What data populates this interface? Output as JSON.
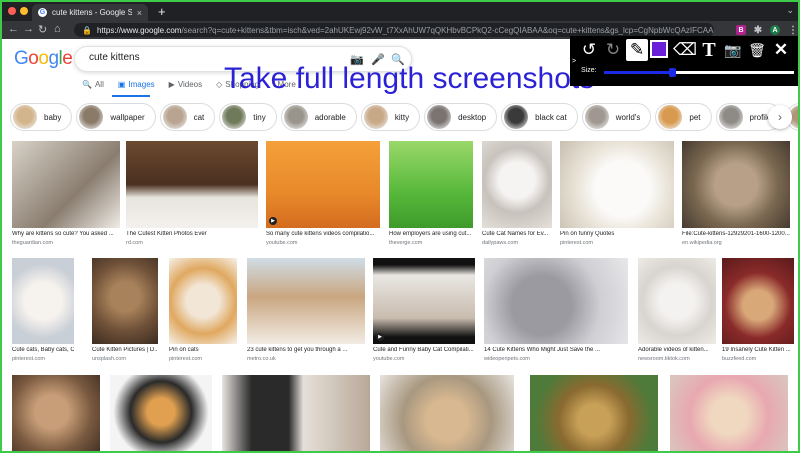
{
  "browser": {
    "tab_title": "cute kittens - Google Search",
    "tab_close": "×",
    "new_tab": "+",
    "tab_dropdown": "⌄",
    "url_host": "https://www.google.com",
    "url_path": "/search?q=cute+kittens&tbm=isch&ved=2ahUKEwj92vW_t7XxAhUW7qQKHbvBCPkQ2-cCegQIABAA&oq=cute+kittens&gs_lcp=CgNpbWcQAzIFCAAQsQMyAggAMgIIADIC",
    "nav_back": "←",
    "nav_forward": "→",
    "nav_reload": "↻",
    "nav_home": "⌂",
    "lock": "🔒",
    "ext_b": "B",
    "ext_puzzle": "✱",
    "ext_avatar": "A",
    "menu": "⋮",
    "colors": {
      "dot_red": "#ff5f57",
      "dot_yellow": "#febc2e",
      "dot_green": "#28c840"
    }
  },
  "google": {
    "logo_letters": [
      "G",
      "o",
      "o",
      "g",
      "l",
      "e"
    ],
    "logo_colors": [
      "#4285f4",
      "#ea4335",
      "#fbbc05",
      "#4285f4",
      "#34a853",
      "#ea4335"
    ],
    "search_value": "cute kittens",
    "camera_icon": "📷",
    "mic_icon": "🎤",
    "search_icon": "🔍",
    "tabs": [
      {
        "icon": "🔍",
        "label": "All"
      },
      {
        "icon": "▣",
        "label": "Images"
      },
      {
        "icon": "▶",
        "label": "Videos"
      },
      {
        "icon": "◇",
        "label": "Shopping"
      },
      {
        "icon": "",
        "label": ":  More"
      }
    ]
  },
  "overlay_text": "Take full length screenshots",
  "chips": [
    {
      "label": "baby",
      "thumb": "#d4b48a"
    },
    {
      "label": "wallpaper",
      "thumb": "#8a7a68"
    },
    {
      "label": "cat",
      "thumb": "#b8a490"
    },
    {
      "label": "tiny",
      "thumb": "#6f7a5a"
    },
    {
      "label": "adorable",
      "thumb": "#9a958c"
    },
    {
      "label": "kitty",
      "thumb": "#c9a888"
    },
    {
      "label": "desktop",
      "thumb": "#7a7370"
    },
    {
      "label": "black cat",
      "thumb": "#3a3a3a"
    },
    {
      "label": "world's",
      "thumb": "#a09890"
    },
    {
      "label": "pet",
      "thumb": "#d89a4e"
    },
    {
      "label": "profile",
      "thumb": "#8e8a86"
    },
    {
      "label": "four",
      "thumb": "#b09678"
    }
  ],
  "chip_next": "›",
  "results_row1": [
    {
      "caption": "Why are kittens so cute? You asked ...",
      "source": "theguardian.com",
      "bg": "linear-gradient(135deg,#d8d2c8,#8a7d70 60%,#f0ece6)",
      "video": false
    },
    {
      "caption": "The Cutest Kitten Photos Ever",
      "source": "rd.com",
      "bg": "linear-gradient(180deg,#6b4a30 0%,#4a3020 50%,#e8e4de 65%,#f3f1ee)",
      "video": false
    },
    {
      "caption": "So many cute kittens videos compilatio...",
      "source": "youtube.com",
      "bg": "linear-gradient(180deg,#f4a03a 0%,#e8892a 60%,#d46c20)",
      "video": true
    },
    {
      "caption": "How employers are using cut...",
      "source": "theverge.com",
      "bg": "linear-gradient(180deg,#9ad86a,#56b83a 60%,#3e9a2a)",
      "video": false
    },
    {
      "caption": "Cute Cat Names for Ev...",
      "source": "dailypaws.com",
      "bg": "radial-gradient(circle at 50% 45%,#f6f4f2 30%,#c8c2bc 55%,#e6e0da)",
      "video": false
    },
    {
      "caption": "Pin on funny Quotes",
      "source": "pinterest.com",
      "bg": "radial-gradient(circle at 55% 55%,#fbfaf8 35%,#e8e2d6 60%,#c8beb0)",
      "video": false
    },
    {
      "caption": "File:Cute-kittens-12929201-1600-1200...",
      "source": "en.wikipedia.org",
      "bg": "radial-gradient(circle at 50% 50%,#b8a088 30%,#7a6850 60%,#463a30)",
      "video": false
    }
  ],
  "results_row2": [
    {
      "caption": "Cute cats, Baby cats, C...",
      "source": "pinterest.com",
      "bg": "radial-gradient(circle at 50% 50%,#f6f2ee 35%,#c9cfd6 70%)",
      "video": false
    },
    {
      "caption": "Cute Kitten Pictures | D...",
      "source": "unsplash.com",
      "bg": "radial-gradient(circle at 50% 45%,#a8825a 25%,#6e5038 60%,#3c2c20)",
      "video": false
    },
    {
      "caption": "Pin on cats",
      "source": "pinterest.com",
      "bg": "radial-gradient(circle at 50% 50%,#f2e6d6 30%,#e0a860 60%,#f6f2ea)",
      "video": false
    },
    {
      "caption": "23 cute kittens to get you through a ...",
      "source": "metro.co.uk",
      "bg": "linear-gradient(180deg,#d0dde6 0%,#c9a680 45%,#f2ece4)",
      "video": false
    },
    {
      "caption": "Cute and Funny Baby Cat Compilati...",
      "source": "youtube.com",
      "bg": "linear-gradient(180deg,#111 0%,#111 8%,#e9e6e2 20%,#c8bcae 70%,#111 92%)",
      "video": true
    },
    {
      "caption": "14 Cute Kittens Who Might Just Save the ...",
      "source": "wideopenpets.com",
      "bg": "radial-gradient(circle at 40% 55%,#9a9aa0 30%,#cfcfd4 60%,#e8e8ea)",
      "video": false
    },
    {
      "caption": "Adorable videos of kitten...",
      "source": "newsroom.tiktok.com",
      "bg": "radial-gradient(circle at 50% 50%,#f4f2f0 30%,#d8d4d0 60%,#eeeae6)",
      "video": false
    },
    {
      "caption": "19 Insanely Cute Kitten ...",
      "source": "buzzfeed.com",
      "bg": "radial-gradient(circle at 50% 55%,#d8a878 25%,#8a2a2a 55%,#5a1a1a)",
      "video": false
    }
  ],
  "results_row3": [
    {
      "bg": "radial-gradient(circle at 45% 45%,#c89e78 25%,#7a5a40 60%,#3c2c22)"
    },
    {
      "bg": "radial-gradient(circle at 50% 45%,#e0a050 20%,#2a2a2a 45%,#f4f4f4 70%)"
    },
    {
      "bg": "linear-gradient(90deg,#e8e4e0 0%,#2a2a2a 20%,#2a2a2a 45%,#e6e0da 55%,#b8a898 100%)"
    },
    {
      "bg": "radial-gradient(circle at 50% 55%,#d8b890 25%,#a89880 55%,#e8e4e0)"
    },
    {
      "bg": "radial-gradient(circle at 50% 55%,#c8a058 20%,#8a6a30 45%,#4e7a3a 75%)"
    },
    {
      "bg": "radial-gradient(circle at 50% 50%,#f0d8c0 25%,#e8a8b0 55%,#d8c8c0)"
    }
  ],
  "tool_panel": {
    "undo": "↺",
    "redo": "↻",
    "pen": "✎",
    "eraser": "⌫",
    "text": "T",
    "camera": "📷",
    "trash": "🗑",
    "close": "✕",
    "size_caret": ">",
    "size_label": "Size:",
    "size_value": 0.36,
    "color": "#6a1fd9",
    "slider_color": "#1a2ae6"
  }
}
